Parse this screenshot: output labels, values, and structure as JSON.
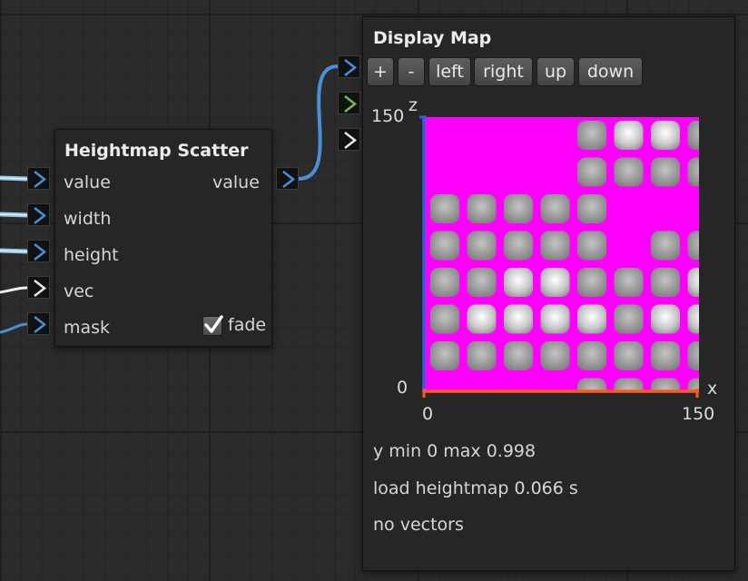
{
  "heightmap_scatter": {
    "title": "Heightmap Scatter",
    "inputs": [
      "value",
      "width",
      "height",
      "vec",
      "mask"
    ],
    "output": "value",
    "fade_label": "fade",
    "fade_checked": true
  },
  "display_map": {
    "title": "Display Map",
    "toolbar": [
      "+",
      "-",
      "left",
      "right",
      "up",
      "down"
    ],
    "axes": {
      "z_label": "z",
      "x_label": "x",
      "z_max": "150",
      "z_min": "0",
      "x_min": "0",
      "x_max": "150"
    },
    "stats": [
      "y min 0 max 0.998",
      "load heightmap 0.066 s",
      "no vectors"
    ]
  },
  "colors": {
    "port_blue": "#4a90d9",
    "port_green": "#7ab860",
    "port_white": "#e8e8e8",
    "map_background": "#ff00ff",
    "z_axis": "#3060e0",
    "x_axis": "#ff5a1a"
  },
  "icons": {
    "port": "chevron-right-icon",
    "checkbox": "checkmark-icon"
  }
}
